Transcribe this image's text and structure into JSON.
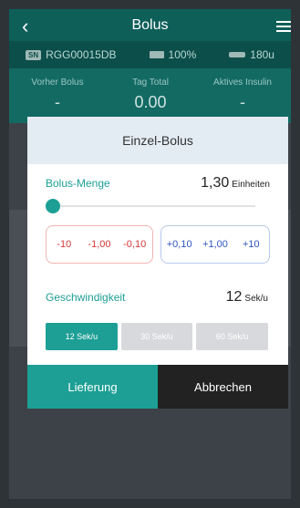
{
  "header": {
    "title": "Bolus"
  },
  "status": {
    "serial": "RGG00015DB",
    "sn_badge": "SN",
    "battery": "100%",
    "reservoir": "180u"
  },
  "tiles": [
    {
      "label": "Vorher Bolus",
      "value": "-"
    },
    {
      "label": "Tag Total",
      "value": "0.00"
    },
    {
      "label": "Aktives Insulin",
      "value": "-"
    }
  ],
  "modal": {
    "title": "Einzel-Bolus",
    "bolus_label": "Bolus-Menge",
    "bolus_value": "1,30",
    "bolus_unit": "Einheiten",
    "slider_fraction": 0.0,
    "minus_buttons": [
      "-10",
      "-1,00",
      "-0,10"
    ],
    "plus_buttons": [
      "+0,10",
      "+1,00",
      "+10"
    ],
    "speed_label": "Geschwindigkeit",
    "speed_value": "12",
    "speed_unit": "Sek/u",
    "speed_options": [
      "12 Sek/u",
      "30 Sek/u",
      "60 Sek/u"
    ],
    "selected_speed": "12 Sek/u",
    "deliver_label": "Lieferung",
    "cancel_label": "Abbrechen"
  },
  "colors": {
    "accent": "#1d9f95",
    "minus": "#d33838",
    "plus": "#2c54c0",
    "cancel_bg": "#222222"
  },
  "icons": [
    "back-icon",
    "menu-icon",
    "battery-icon",
    "reservoir-icon"
  ]
}
